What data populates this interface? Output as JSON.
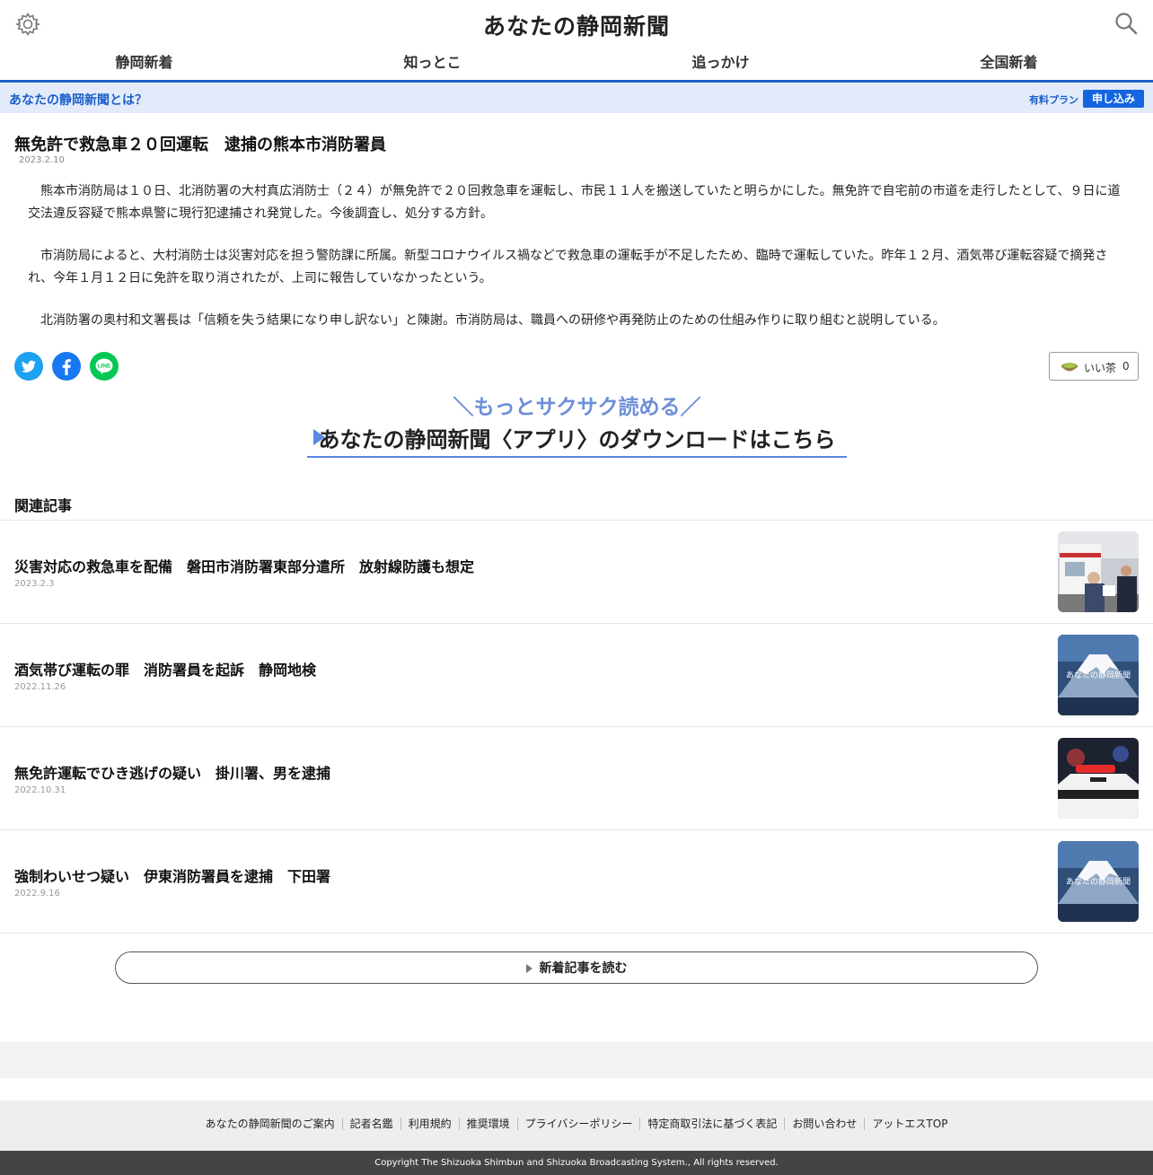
{
  "header": {
    "site_title": "あなたの静岡新聞",
    "settings_icon": "gear-icon",
    "search_icon": "search-icon"
  },
  "nav": {
    "tabs": [
      "静岡新着",
      "知っとこ",
      "追っかけ",
      "全国新着"
    ],
    "accent_color": "#1a5fc9"
  },
  "infobar": {
    "about_link": "あなたの静岡新聞とは？",
    "plan_label": "有料プラン",
    "apply_button": "申し込み"
  },
  "article": {
    "title": "無免許で救急車２０回運転　逮捕の熊本市消防署員",
    "date": "2023.2.10",
    "paragraphs": [
      "熊本市消防局は１０日、北消防署の大村真広消防士（２４）が無免許で２０回救急車を運転し、市民１１人を搬送していたと明らかにした。無免許で自宅前の市道を走行したとして、９日に道交法違反容疑で熊本県警に現行犯逮捕され発覚した。今後調査し、処分する方針。",
      "市消防局によると、大村消防士は災害対応を担う警防課に所属。新型コロナウイルス禍などで救急車の運転手が不足したため、臨時で運転していた。昨年１２月、酒気帯び運転容疑で摘発され、今年１月１２日に免許を取り消されたが、上司に報告していなかったという。",
      "北消防署の奥村和文署長は「信頼を失う結果になり申し訳ない」と陳謝。市消防局は、職員への研修や再発防止のための仕組み作りに取り組むと説明している。"
    ]
  },
  "share": {
    "icons": [
      "twitter-icon",
      "facebook-icon",
      "line-icon"
    ]
  },
  "tea": {
    "label": "いい茶",
    "count": "0"
  },
  "app_banner": {
    "tagline": "＼もっとサクサク読める／",
    "main_text": "あなたの静岡新聞〈アプリ〉のダウンロードはこちら"
  },
  "related": {
    "heading": "関連記事",
    "items": [
      {
        "title": "災害対応の救急車を配備　磐田市消防署東部分遣所　放射線防護も想定",
        "date": "2023.2.3",
        "thumb_caption": ""
      },
      {
        "title": "酒気帯び運転の罪　消防署員を起訴　静岡地検",
        "date": "2022.11.26",
        "thumb_caption": "あなたの静岡新聞"
      },
      {
        "title": "無免許運転でひき逃げの疑い　掛川署、男を逮捕",
        "date": "2022.10.31",
        "thumb_caption": ""
      },
      {
        "title": "強制わいせつ疑い　伊東消防署員を逮捕　下田署",
        "date": "2022.9.16",
        "thumb_caption": "あなたの静岡新聞"
      }
    ]
  },
  "more_button": "新着記事を読む",
  "footer": {
    "links": [
      "あなたの静岡新聞のご案内",
      "記者名鑑",
      "利用規約",
      "推奨環境",
      "プライバシーポリシー",
      "特定商取引法に基づく表記",
      "お問い合わせ",
      "アットエスTOP"
    ],
    "copyright": "Copyright The Shizuoka Shimbun and Shizuoka Broadcasting System., All rights reserved."
  }
}
